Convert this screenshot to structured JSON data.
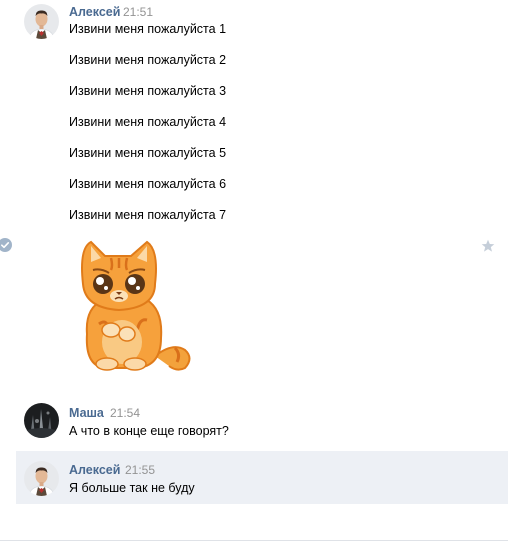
{
  "messages": [
    {
      "author": "Алексей",
      "time": "21:51",
      "lines": [
        "Извини меня пожалуйста 1",
        "Извини меня пожалуйста 2",
        "Извини меня пожалуйста 3",
        "Извини меня пожалуйста 4",
        "Извини меня пожалуйста 5",
        "Извини меня пожалуйста 6",
        "Извини меня пожалуйста 7"
      ],
      "sticker": "sad-cat-sticker"
    },
    {
      "author": "Маша",
      "time": "21:54",
      "lines": [
        "А что в конце еще говорят?"
      ]
    },
    {
      "author": "Алексей",
      "time": "21:55",
      "lines": [
        "Я больше так не буду"
      ]
    }
  ],
  "icons": {
    "read_mark": "check-circle-icon",
    "favorite": "star-icon"
  },
  "colors": {
    "author": "#4a6a91",
    "time": "#939393",
    "selected_bg": "#edf0f5",
    "check": "#a1b4c9"
  }
}
